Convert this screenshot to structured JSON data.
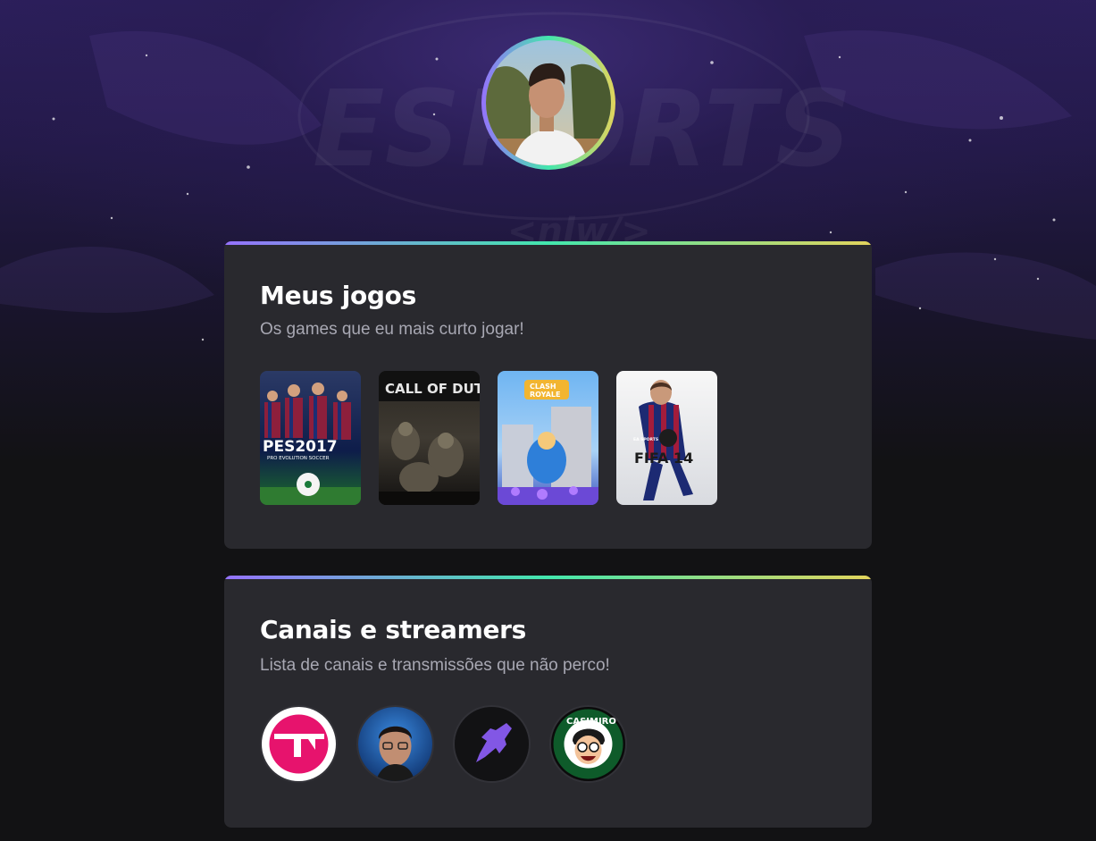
{
  "profile": {
    "avatar_icon": "profile-photo",
    "background_logo_text": "ESPORTS",
    "background_tag_text": "<nlw/>"
  },
  "games_section": {
    "title": "Meus jogos",
    "subtitle": "Os games que eu mais curto jogar!",
    "games": [
      {
        "name": "PES 2017",
        "line1": "PES2017",
        "line2": "PRO EVOLUTION SOCCER"
      },
      {
        "name": "Call of Duty",
        "line1": "CALL OF DUTY",
        "line2": ""
      },
      {
        "name": "Clash Royale",
        "line1": "CLASH",
        "line2": "ROYALE"
      },
      {
        "name": "FIFA 14",
        "line1": "FIFA 14",
        "line2": "EA SPORTS"
      }
    ]
  },
  "streams_section": {
    "title": "Canais e streamers",
    "subtitle": "Lista de canais e transmissões que não perco!",
    "streams": [
      {
        "icon": "tnt-sports-icon"
      },
      {
        "icon": "streamer-avatar-icon"
      },
      {
        "icon": "rocketseat-icon"
      },
      {
        "icon": "casimiro-icon",
        "label": "CASIMIRO"
      }
    ]
  },
  "colors": {
    "gradient_start": "#9572fc",
    "gradient_mid": "#43e7ad",
    "gradient_end": "#e2d45c",
    "card_bg": "#29292e",
    "page_bg": "#121214"
  }
}
